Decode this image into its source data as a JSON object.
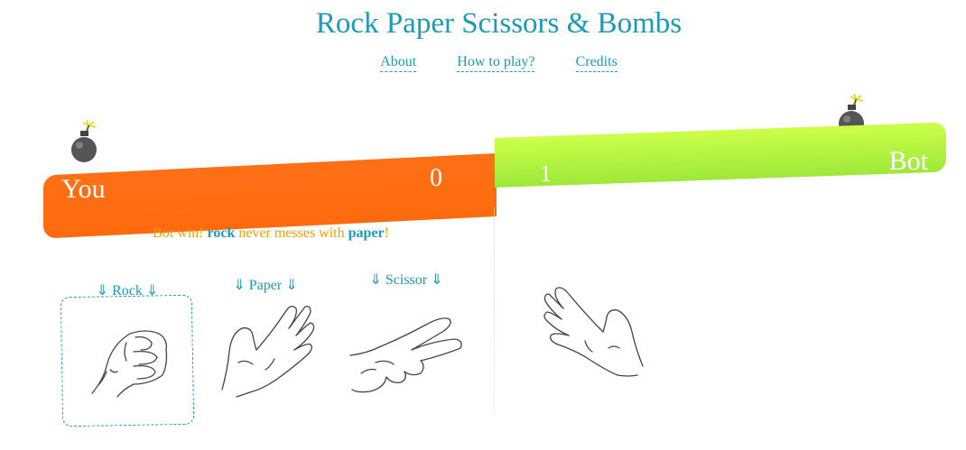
{
  "app": {
    "title": "Rock Paper Scissors & Bombs"
  },
  "nav": {
    "items": [
      "About",
      "How to play?",
      "Credits"
    ]
  },
  "scoreboard": {
    "player_label": "You",
    "player_score": "0",
    "bot_label": "Bot",
    "bot_score": "1",
    "player_color": "#ff6a0e",
    "bot_color": "#b4f040"
  },
  "result": {
    "prefix": "Bot win! ",
    "winner_move": "rock",
    "middle": " never messes with ",
    "loser_move": "paper",
    "suffix": "!"
  },
  "choices": [
    {
      "label": "⇓ Rock ⇓",
      "icon": "rock-hand-icon",
      "selected": true
    },
    {
      "label": "⇓ Paper ⇓",
      "icon": "paper-hand-icon",
      "selected": false
    },
    {
      "label": "⇓ Scissor ⇓",
      "icon": "scissor-hand-icon",
      "selected": false
    }
  ],
  "bot_choice": {
    "icon": "paper-hand-icon"
  },
  "colors": {
    "accent": "#1a9bb8",
    "result": "#f0a000"
  }
}
